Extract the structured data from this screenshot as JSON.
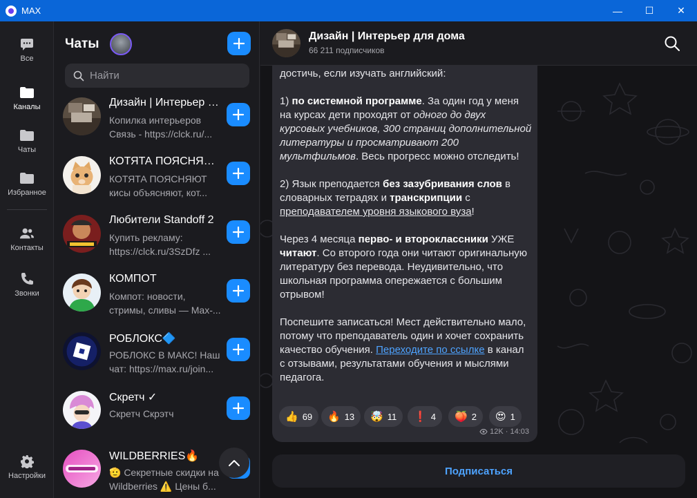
{
  "window": {
    "title": "MAX",
    "minimize": "—",
    "maximize": "☐",
    "close": "✕"
  },
  "nav": [
    {
      "label": "Все",
      "icon": "chat-bubble-icon"
    },
    {
      "label": "Каналы",
      "icon": "folder-icon"
    },
    {
      "label": "Чаты",
      "icon": "folder-icon"
    },
    {
      "label": "Избранное",
      "icon": "folder-icon"
    },
    {
      "label": "Контакты",
      "icon": "contacts-icon"
    },
    {
      "label": "Звонки",
      "icon": "phone-icon"
    },
    {
      "label": "Настройки",
      "icon": "gear-icon"
    }
  ],
  "list": {
    "title": "Чаты",
    "search_placeholder": "Найти",
    "chats": [
      {
        "name": "Дизайн | Интерьер для дома",
        "line1": "Копилка интерьеров",
        "line2": "Связь - https://clck.ru/..."
      },
      {
        "name": "КОТЯТА ПОЯСНЯЮТ",
        "line1": "КОТЯТА ПОЯСНЯЮТ",
        "line2": "кисы объясняют, кот..."
      },
      {
        "name": "Любители Standoff 2",
        "line1": "Купить рекламу:",
        "line2": "https://clck.ru/3SzDfz ..."
      },
      {
        "name": "КОМПОТ",
        "line1": "Компот: новости,",
        "line2": "стримы, сливы — Max-..."
      },
      {
        "name": "РОБЛОКС🔷",
        "line1": "РОБЛОКС В МАКС! Наш",
        "line2": "чат: https://max.ru/join..."
      },
      {
        "name": "Скретч ✓",
        "line1": "Скретч Скрэтч",
        "line2": ""
      },
      {
        "name": "WILDBERRIES🔥",
        "line1": "🫡 Секретные скидки на",
        "line2": "Wildberries ⚠️ Цены б..."
      }
    ]
  },
  "channel": {
    "title": "Дизайн | Интерьер для дома",
    "subscribers": "66 211 подписчиков",
    "message": {
      "p0": "достичь, если изучать английский:",
      "p1_a": "1) ",
      "p1_b": "по системной программе",
      "p1_c": ". За один год у меня на курсах дети проходят от ",
      "p1_d": "одного до двух курсовых учебников, 300 страниц дополнительной литературы и просматривают 200 мультфильмов",
      "p1_e": ". Весь прогресс можно отследить!",
      "p2_a": "2) Язык преподается ",
      "p2_b": "без зазубривания слов",
      "p2_c": " в словарных тетрадях и ",
      "p2_d": "транскрипции",
      "p2_e": " с ",
      "p2_f": "преподавателем уровня языкового вуза",
      "p2_g": "!",
      "p3_a": "Через 4 месяца ",
      "p3_b": "перво- и второклассники",
      "p3_c": " УЖЕ ",
      "p3_d": "читают",
      "p3_e": ". Со второго года они читают оригинальную литературу без перевода. Неудивительно, что школьная программа опережается с большим отрывом!",
      "p4_a": "Поспешите записаться! Мест действительно мало, потому что преподаватель один и хочет сохранить качество обучения. ",
      "p4_b": "Переходите по ссылке",
      "p4_c": " в канал с отзывами, результатами обучения и мыслями педагога."
    },
    "reactions": [
      {
        "emoji": "👍",
        "count": "69"
      },
      {
        "emoji": "🔥",
        "count": "13"
      },
      {
        "emoji": "🤯",
        "count": "11"
      },
      {
        "emoji": "❗",
        "count": "4"
      },
      {
        "emoji": "🍑",
        "count": "2"
      },
      {
        "emoji": "😍",
        "count": "1"
      }
    ],
    "views_time": "12K · 14:03",
    "subscribe_label": "Подписаться"
  }
}
